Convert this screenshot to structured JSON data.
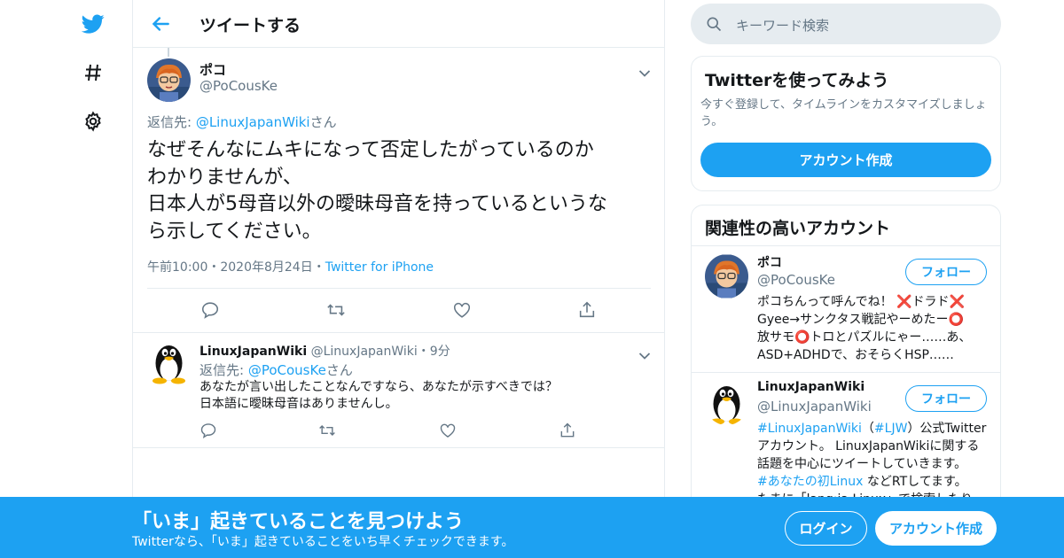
{
  "nav": {
    "icons": [
      "twitter-logo-icon",
      "hashtag-icon",
      "gear-icon"
    ]
  },
  "header": {
    "title": "ツイートする"
  },
  "tweet": {
    "name": "ポコ",
    "handle": "@PoCousKe",
    "reply_prefix": "返信先: ",
    "reply_to": "@LinuxJapanWiki",
    "reply_suffix": "さん",
    "body": "なぜそんなにムキになって否定したがっているのか\nわかりませんが、\n日本人が5母音以外の曖昧母音を持っているというな\nら示してください。",
    "time": "午前10:00",
    "date": "2020年8月24日",
    "source": "Twitter for iPhone",
    "dot": "・"
  },
  "reply": {
    "name": "LinuxJapanWiki",
    "handle": "@LinuxJapanWiki",
    "dot": "・",
    "time": "9分",
    "reply_prefix": "返信先: ",
    "reply_to": "@PoCousKe",
    "reply_suffix": "さん",
    "body": "あなたが言い出したことなんですなら、あなたが示すべきでは？\n日本語に曖昧母音はありませんし。"
  },
  "search": {
    "placeholder": "キーワード検索"
  },
  "signup_card": {
    "title": "Twitterを使ってみよう",
    "desc": "今すぐ登録して、タイムラインをカスタマイズしましょう。",
    "button": "アカウント作成"
  },
  "related": {
    "title": "関連性の高いアカウント",
    "follow_label": "フォロー",
    "accounts": [
      {
        "name": "ポコ",
        "handle": "@PoCousKe",
        "bio": "ポコちんって呼んでね！ ❌ドラド❌\nGyee→サンクタス戦記やーめたー⭕\n放サモ⭕トロとパズルにゃー……あ、\nASD+ADHDで、おそらくHSP……"
      },
      {
        "name": "LinuxJapanWiki",
        "handle": "@LinuxJapanWiki",
        "bio_tag1": "#LinuxJapanWiki",
        "bio_p1": "（",
        "bio_tag2": "#LJW",
        "bio_p2": "）公式Twitter\nアカウント。 LinuxJapanWikiに関する\n話題を中心にツイートしていきます。\n",
        "bio_tag3": "#あなたの初Linux",
        "bio_p3": " などRTしてます。\nたまに「lang:ja Linux」で検索したり"
      }
    ]
  },
  "bottom_bar": {
    "title": "「いま」起きていることを見つけよう",
    "subtitle": "Twitterなら、「いま」起きていることをいち早くチェックできます。",
    "login": "ログイン",
    "signup": "アカウント作成"
  },
  "colors": {
    "accent": "#1da1f2",
    "muted": "#657786",
    "border": "#e6ecf0",
    "search_bg": "#e6ecf0"
  }
}
